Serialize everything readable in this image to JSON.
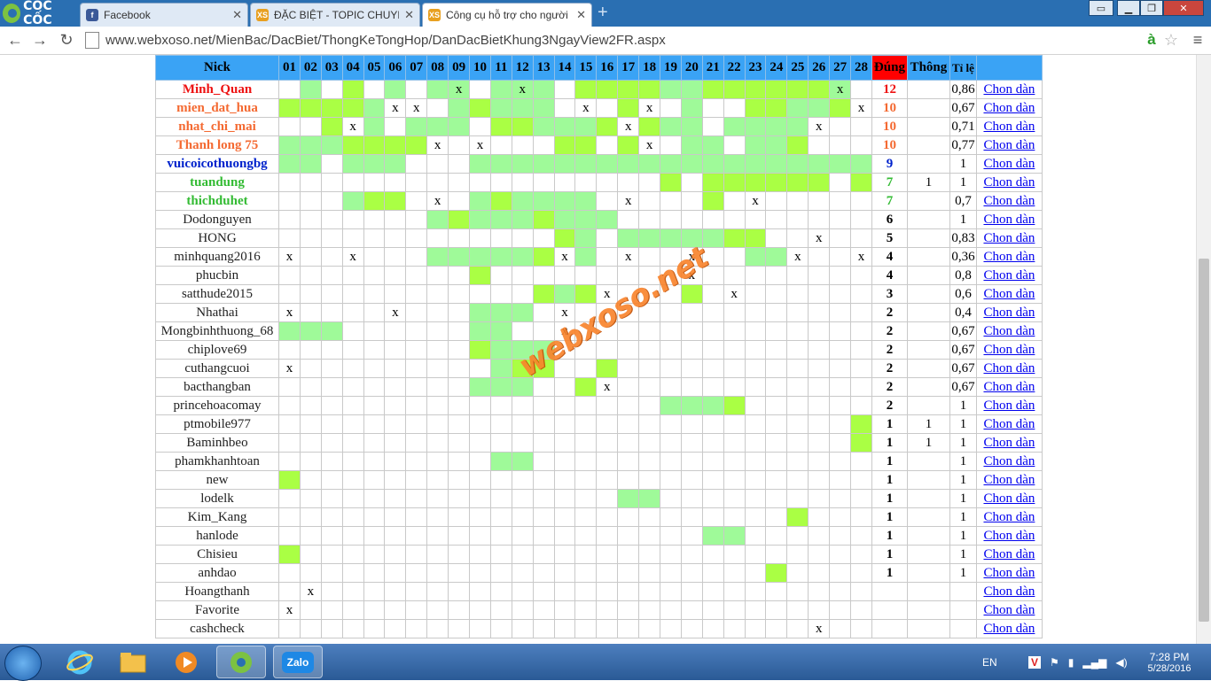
{
  "browser": {
    "brand": "CỐC CỐC",
    "tabs": [
      {
        "title": "Facebook",
        "icon": "facebook-icon",
        "icon_color": "#3b5998"
      },
      {
        "title": "ĐẶC BIỆT - TOPIC CHUYÊN",
        "icon": "xs-icon",
        "icon_color": "#e8a020"
      },
      {
        "title": "Công cụ hỗ trợ cho người",
        "icon": "xs-icon",
        "icon_color": "#e8a020"
      }
    ],
    "url": "www.webxoso.net/MienBac/DacBiet/ThongKeTongHop/DanDacBietKhung3NgayView2FR.aspx"
  },
  "table": {
    "headers": {
      "nick": "Nick",
      "dung": "Đúng",
      "thong": "Thông",
      "tile": "Tỉ lệ"
    },
    "days": [
      "01",
      "02",
      "03",
      "04",
      "05",
      "06",
      "07",
      "08",
      "09",
      "10",
      "11",
      "12",
      "13",
      "14",
      "15",
      "16",
      "17",
      "18",
      "19",
      "20",
      "21",
      "22",
      "23",
      "24",
      "25",
      "26",
      "27",
      "28"
    ],
    "rows": [
      {
        "nick": "Minh_Quan",
        "color": "#ee1111",
        "bold": true,
        "cells": "01020101c01c10222211222222c0",
        "dung": "12",
        "thong": "",
        "tile": "0,86",
        "link": "Chon dàn"
      },
      {
        "nick": "mien_dat_hua",
        "color": "#f46a32",
        "bold": true,
        "cells": "22221xx0121110x02x010022112x",
        "dung": "10",
        "thong": "",
        "tile": "0,67",
        "link": "Chon dàn"
      },
      {
        "nick": "nhat_chi_mai",
        "color": "#f46a32",
        "bold": true,
        "cells": "002x101110221112x21101111x00",
        "dung": "10",
        "thong": "",
        "tile": "0,71",
        "link": "Chon dàn"
      },
      {
        "nick": "Thanh long 75",
        "color": "#f46a32",
        "bold": true,
        "cells": "1112222x0x0002202x0110112000",
        "dung": "10",
        "thong": "",
        "tile": "0,77",
        "link": "Chon dàn"
      },
      {
        "nick": "vuicoicothuongbg",
        "color": "#0022cc",
        "bold": true,
        "cells": "1101110001111111111111111111",
        "dung": "9",
        "thong": "",
        "tile": "1",
        "link": "Chon dàn"
      },
      {
        "nick": "tuandung",
        "color": "#33bb33",
        "bold": true,
        "cells": "0000000000000000002022222202",
        "dung": "7",
        "thong": "1",
        "tile": "1",
        "link": "Chon dàn"
      },
      {
        "nick": "thichduhet",
        "color": "#33bb33",
        "bold": true,
        "cells": "0001220x01211110x00020x00000",
        "dung": "7",
        "thong": "",
        "tile": "0,7",
        "link": "Chon dàn"
      },
      {
        "nick": "Dodonguyen",
        "color": "#222222",
        "bold": false,
        "cells": "0000000121112111000000000000",
        "dung": "6",
        "thong": "",
        "tile": "1",
        "link": "Chon dàn"
      },
      {
        "nick": "HONG",
        "color": "#222222",
        "bold": false,
        "cells": "0000000000000210111112200x00",
        "dung": "5",
        "thong": "",
        "tile": "0,83",
        "link": "Chon dàn"
      },
      {
        "nick": "minhquang2016",
        "color": "#222222",
        "bold": false,
        "cells": "x00x000111112x10x00x0011x00x",
        "dung": "4",
        "thong": "",
        "tile": "0,36",
        "link": "Chon dàn"
      },
      {
        "nick": "phucbin",
        "color": "#222222",
        "bold": false,
        "cells": "0000000002000000000x00000000",
        "dung": "4",
        "thong": "",
        "tile": "0,8",
        "link": "Chon dàn"
      },
      {
        "nick": "satthude2015",
        "color": "#222222",
        "bold": false,
        "cells": "000000000000212x00020x000000",
        "dung": "3",
        "thong": "",
        "tile": "0,6",
        "link": "Chon dàn"
      },
      {
        "nick": "Nhathai",
        "color": "#222222",
        "bold": false,
        "cells": "x0000x0001110x00000000000000",
        "dung": "2",
        "thong": "",
        "tile": "0,4",
        "link": "Chon dàn"
      },
      {
        "nick": "Mongbinhthuong_68",
        "color": "#222222",
        "bold": false,
        "cells": "1110000001100x00000000000000",
        "dung": "2",
        "thong": "",
        "tile": "0,67",
        "link": "Chon dàn"
      },
      {
        "nick": "chiplove69",
        "color": "#222222",
        "bold": false,
        "cells": "0000000002111000000000000000",
        "dung": "2",
        "thong": "",
        "tile": "0,67",
        "link": "Chon dàn"
      },
      {
        "nick": "cuthangcuoi",
        "color": "#222222",
        "bold": false,
        "cells": "x000000000122002000000000000",
        "dung": "2",
        "thong": "",
        "tile": "0,67",
        "link": "Chon dàn"
      },
      {
        "nick": "bacthangban",
        "color": "#222222",
        "bold": false,
        "cells": "000000000111002x000000000000",
        "dung": "2",
        "thong": "",
        "tile": "0,67",
        "link": "Chon dàn"
      },
      {
        "nick": "princehoacomay",
        "color": "#222222",
        "bold": false,
        "cells": "0000000000000000001112000000",
        "dung": "2",
        "thong": "",
        "tile": "1",
        "link": "Chon dàn"
      },
      {
        "nick": "ptmobile977",
        "color": "#222222",
        "bold": false,
        "cells": "0000000000000000000000000002",
        "dung": "1",
        "thong": "1",
        "tile": "1",
        "link": "Chon dàn"
      },
      {
        "nick": "Baminhbeo",
        "color": "#222222",
        "bold": false,
        "cells": "0000000000000000000000000002",
        "dung": "1",
        "thong": "1",
        "tile": "1",
        "link": "Chon dàn"
      },
      {
        "nick": "phamkhanhtoan",
        "color": "#222222",
        "bold": false,
        "cells": "0000000000110000000000000000",
        "dung": "1",
        "thong": "",
        "tile": "1",
        "link": "Chon dàn"
      },
      {
        "nick": "new",
        "color": "#222222",
        "bold": false,
        "cells": "2000000000000000000000000000",
        "dung": "1",
        "thong": "",
        "tile": "1",
        "link": "Chon dàn"
      },
      {
        "nick": "lodelk",
        "color": "#222222",
        "bold": false,
        "cells": "0000000000000000110000000000",
        "dung": "1",
        "thong": "",
        "tile": "1",
        "link": "Chon dàn"
      },
      {
        "nick": "Kim_Kang",
        "color": "#222222",
        "bold": false,
        "cells": "0000000000000000000000002000",
        "dung": "1",
        "thong": "",
        "tile": "1",
        "link": "Chon dàn"
      },
      {
        "nick": "hanlode",
        "color": "#222222",
        "bold": false,
        "cells": "0000000000000000000011000000",
        "dung": "1",
        "thong": "",
        "tile": "1",
        "link": "Chon dàn"
      },
      {
        "nick": "Chisieu",
        "color": "#222222",
        "bold": false,
        "cells": "2000000000000000000000000000",
        "dung": "1",
        "thong": "",
        "tile": "1",
        "link": "Chon dàn"
      },
      {
        "nick": "anhdao",
        "color": "#222222",
        "bold": false,
        "cells": "0000000000000000000000020000",
        "dung": "1",
        "thong": "",
        "tile": "1",
        "link": "Chon dàn"
      },
      {
        "nick": "Hoangthanh",
        "color": "#222222",
        "bold": false,
        "cells": "0x00000000000000000000000000",
        "dung": "",
        "thong": "",
        "tile": "",
        "link": "Chon dàn"
      },
      {
        "nick": "Favorite",
        "color": "#222222",
        "bold": false,
        "cells": "x000000000000000000000000000",
        "dung": "",
        "thong": "",
        "tile": "",
        "link": "Chon dàn"
      },
      {
        "nick": "cashcheck",
        "color": "#222222",
        "bold": false,
        "cells": "0000000000000000000000000x00",
        "dung": "",
        "thong": "",
        "tile": "",
        "link": "Chon dàn"
      }
    ]
  },
  "watermark": "webxoso.net",
  "taskbar": {
    "lang": "EN",
    "time": "7:28 PM",
    "date": "5/28/2016",
    "zalo": "Zalo"
  }
}
